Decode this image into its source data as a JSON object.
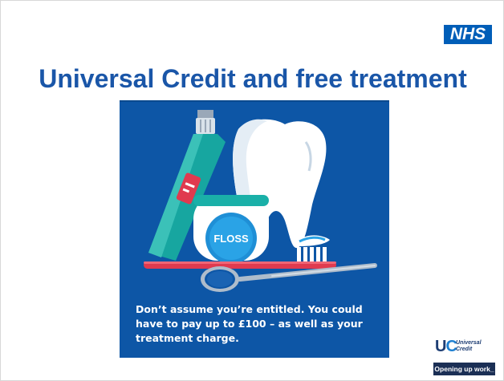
{
  "header": {
    "logo": "NHS",
    "title": "Universal Credit and free treatment"
  },
  "poster": {
    "floss_label": "FLOSS",
    "message": "Don’t assume you’re entitled. You could have to pay up to £100 – as well as your treatment charge.",
    "colors": {
      "background": "#0d56a6",
      "title": "#1a56a8"
    },
    "icons": [
      "toothpaste-tube-icon",
      "tooth-icon",
      "floss-container-icon",
      "toothbrush-icon",
      "dental-mirror-icon"
    ]
  },
  "footer": {
    "uc_mark_u": "U",
    "uc_mark_c": "C",
    "uc_name": "Universal Credit",
    "tagline": "Opening up work_"
  }
}
